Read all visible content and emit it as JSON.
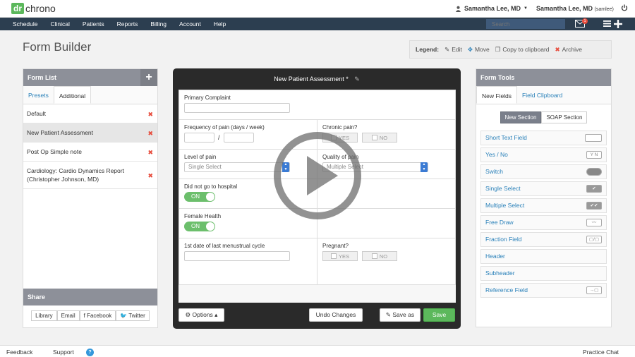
{
  "app": {
    "logo_dr": "dr",
    "logo_chrono": "chrono"
  },
  "header": {
    "user_menu": "Samantha Lee, MD",
    "user_name": "Samantha Lee, MD",
    "user_handle": "(samlee)"
  },
  "nav": {
    "items": [
      "Schedule",
      "Clinical",
      "Patients",
      "Reports",
      "Billing",
      "Account",
      "Help"
    ],
    "search_placeholder": "Search",
    "mail_count": "1"
  },
  "page": {
    "title": "Form Builder"
  },
  "legend": {
    "title": "Legend:",
    "edit": "Edit",
    "move": "Move",
    "copy": "Copy to clipboard",
    "archive": "Archive"
  },
  "form_list": {
    "title": "Form List",
    "tabs": [
      "Presets",
      "Additional"
    ],
    "items": [
      "Default",
      "New Patient Assessment",
      "Post Op Simple note",
      "Cardiology: Cardio Dynamics Report (Christopher Johnson, MD)"
    ],
    "share_title": "Share",
    "share_buttons": [
      "Library",
      "Email",
      "Facebook",
      "Twitter"
    ]
  },
  "builder": {
    "title": "New Patient Assessment *",
    "fields": {
      "primary_complaint": "Primary Complaint",
      "frequency": "Frequency of pain (days / week)",
      "frequency_sep": "/",
      "chronic_pain": "Chronic pain?",
      "level_of_pain": "Level of pain",
      "level_select": "Single Select",
      "quality_of_pain": "Quality of pain",
      "quality_select": "Multiple Select",
      "hospital": "Did not go to hospital",
      "female_health": "Female Health",
      "last_cycle": "1st date of last menustrual cycle",
      "pregnant": "Pregnant?"
    },
    "yes_label": "YES",
    "no_label": "NO",
    "on_label": "ON",
    "footer": {
      "options": "Options",
      "undo": "Undo Changes",
      "save_as": "Save as",
      "save": "Save"
    }
  },
  "form_tools": {
    "title": "Form Tools",
    "tabs": [
      "New Fields",
      "Field Clipboard"
    ],
    "section_buttons": [
      "New Section",
      "SOAP Section"
    ],
    "tools": [
      "Short Text Field",
      "Yes / No",
      "Switch",
      "Single Select",
      "Multiple Select",
      "Free Draw",
      "Fraction Field",
      "Header",
      "Subheader",
      "Reference Field"
    ],
    "yn_icon": "Y N"
  },
  "footer": {
    "feedback": "Feedback",
    "support": "Support",
    "help": "?",
    "practice_chat": "Practice Chat"
  },
  "colors": {
    "nav_bg": "#2c3e50",
    "accent_green": "#5cb85c",
    "link_blue": "#2980b9",
    "delete_red": "#e74c3c",
    "panel_head": "#8d9099"
  }
}
